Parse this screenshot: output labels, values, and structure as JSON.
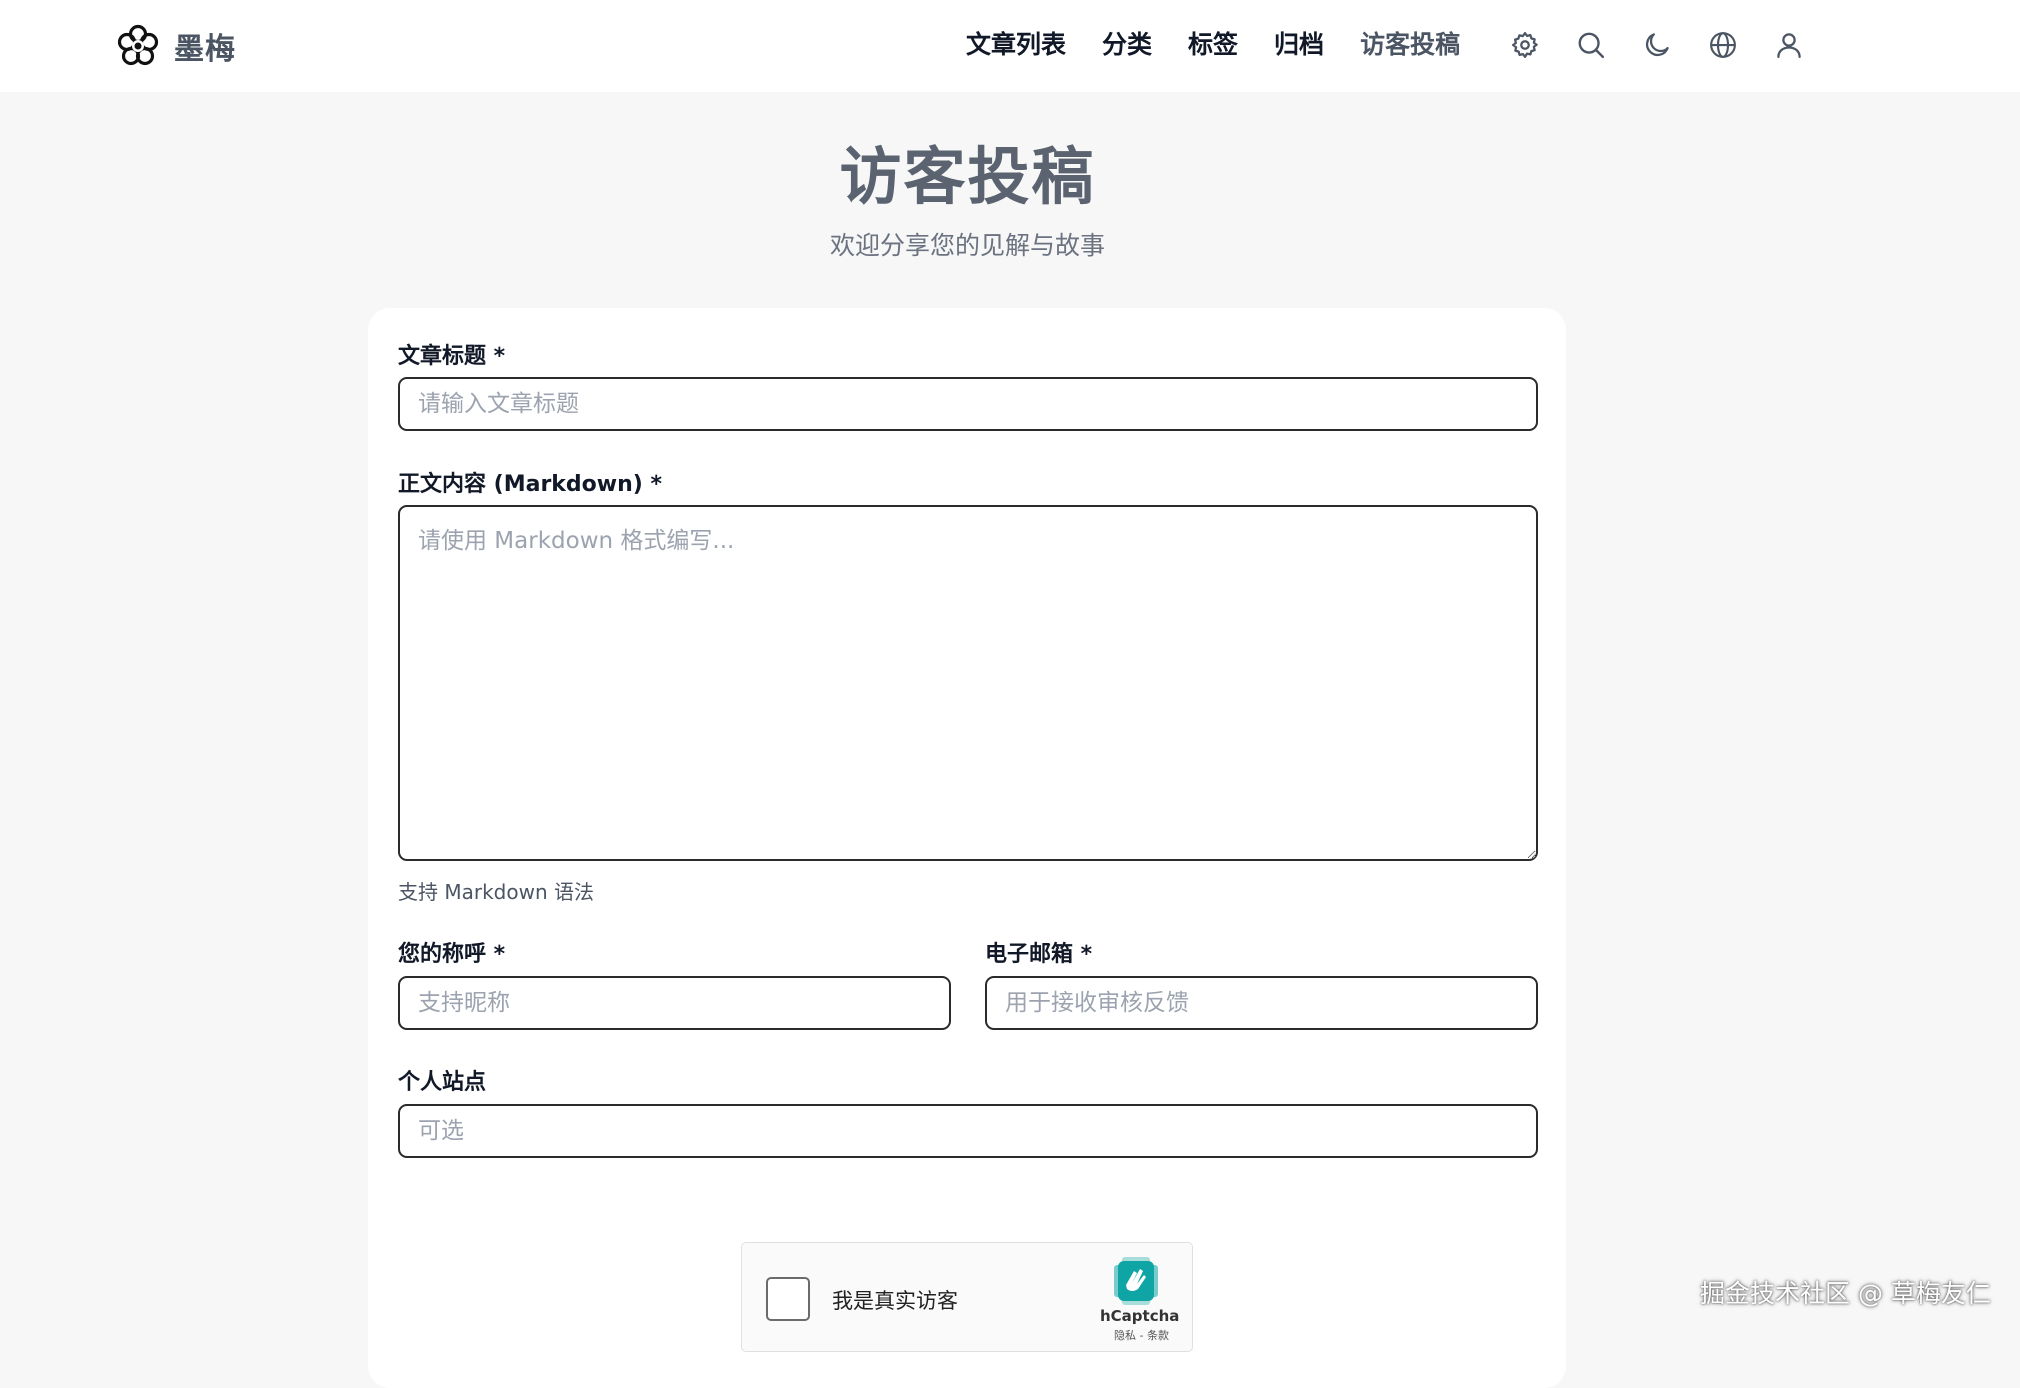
{
  "header": {
    "logo_text": "墨梅",
    "nav": [
      {
        "label": "文章列表"
      },
      {
        "label": "分类"
      },
      {
        "label": "标签"
      },
      {
        "label": "归档"
      },
      {
        "label": "访客投稿",
        "active": true
      }
    ],
    "icons": [
      "gear-icon",
      "search-icon",
      "moon-icon",
      "globe-icon",
      "user-icon"
    ]
  },
  "hero": {
    "title": "访客投稿",
    "subtitle": "欢迎分享您的见解与故事"
  },
  "form": {
    "title_label": "文章标题 *",
    "title_placeholder": "请输入文章标题",
    "content_label": "正文内容 (Markdown) *",
    "content_placeholder": "请使用 Markdown 格式编写...",
    "content_hint": "支持 Markdown 语法",
    "name_label": "您的称呼 *",
    "name_placeholder": "支持昵称",
    "email_label": "电子邮箱 *",
    "email_placeholder": "用于接收审核反馈",
    "site_label": "个人站点",
    "site_placeholder": "可选"
  },
  "captcha": {
    "label": "我是真实访客",
    "brand": "hCaptcha",
    "terms": "隐私 - 条款"
  },
  "watermark": "掘金技术社区 @ 草梅友仁",
  "colors": {
    "page_bg": "#f7f7f7",
    "card_bg": "#ffffff",
    "title_gray": "#5b6371",
    "active_nav": "#4b5563",
    "captcha_teal": "#0ea5a4"
  }
}
